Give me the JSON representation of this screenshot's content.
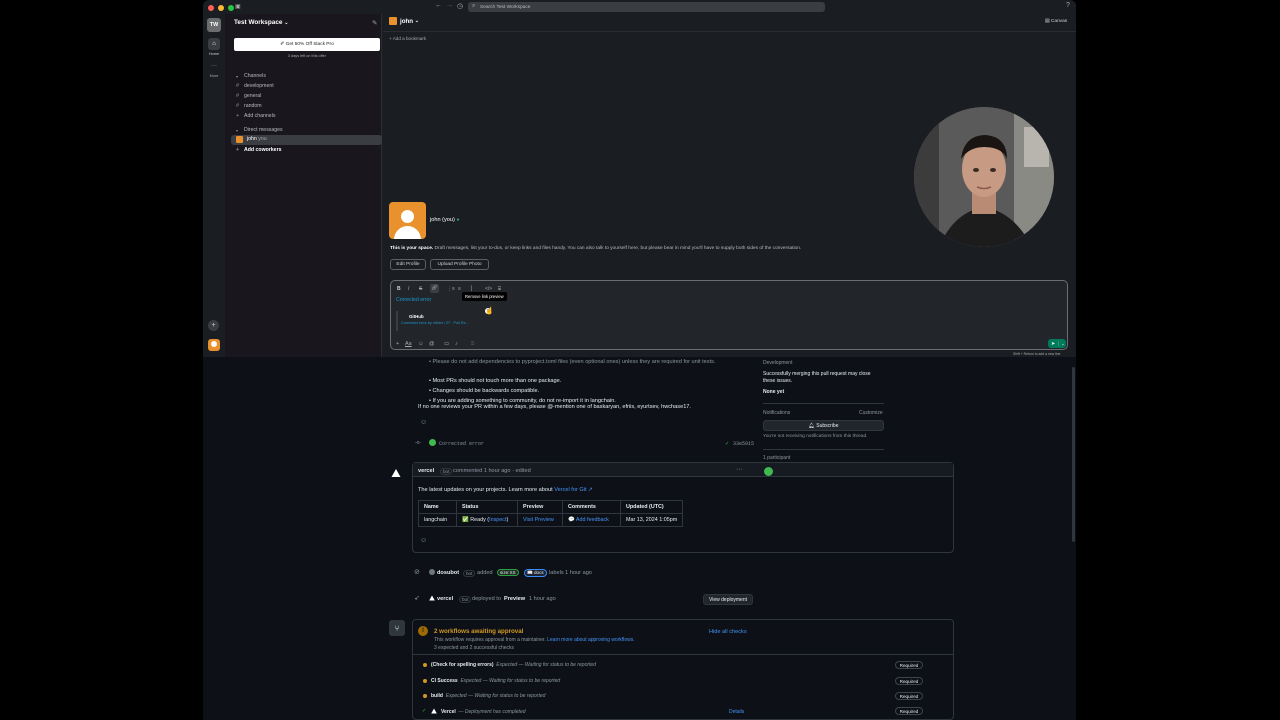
{
  "slack": {
    "search_placeholder": "Search Test Workspace",
    "rail": {
      "workspace_initials": "TW",
      "home_label": "Home",
      "more_label": "More"
    },
    "workspace_name": "Test Workspace",
    "promo": {
      "button_label": "Get 50% Off Slack Pro",
      "subtext": "3 days left on this offer"
    },
    "channels": {
      "header": "Channels",
      "items": [
        "development",
        "general",
        "random"
      ],
      "add_label": "Add channels"
    },
    "dms": {
      "header": "Direct messages",
      "self_name": "john",
      "self_suffix": "you",
      "add_label": "Add coworkers"
    },
    "header": {
      "dm_name": "john",
      "canvas_label": "Canvas",
      "bookmark_label": "Add a bookmark"
    },
    "profile": {
      "name": "john (you)",
      "intro_bold": "This is your space.",
      "intro_rest": " Draft messages, list your to-dos, or keep links and files handy. You can also talk to yourself here, but please bear in mind you'll have to supply both sides of the conversation.",
      "edit_button": "Edit Profile",
      "upload_button": "Upload Profile Photo"
    },
    "composer": {
      "link_text": "Corrected error",
      "tooltip": "Remove link preview",
      "preview_title": "GitHub",
      "preview_subtitle": "Corrected error by nilhim / 27 · Pull Re...",
      "hint": "Shift + Return to add a new line"
    }
  },
  "github": {
    "bullets": [
      "Please do not add dependencies to pyproject.toml files (even optional ones) unless they are required for unit tests.",
      "Most PRs should not touch more than one package.",
      "Changes should be backwards compatible.",
      "If you are adding something to community, do not re-import it in langchain."
    ],
    "mention_text": "If no one reviews your PR within a few days, please @-mention one of baskaryan, efriis, eyurtsev, hwchase17.",
    "commit": {
      "message": "Corrected error",
      "sha": "33e5915"
    },
    "vercel_comment": {
      "author": "vercel",
      "bot_tag": "bot",
      "meta": "commented 1 hour ago · edited",
      "intro": "The latest updates on your projects. Learn more about ",
      "intro_link": "Vercel for Git ↗",
      "table_headers": [
        "Name",
        "Status",
        "Preview",
        "Comments",
        "Updated (UTC)"
      ],
      "row": {
        "name": "langchain",
        "status_prefix": "✅ Ready (",
        "status_link": "Inspect",
        "status_suffix": ")",
        "preview": "Visit Preview",
        "comments": "💬 Add feedback",
        "updated": "Mar 13, 2024 1:05pm"
      }
    },
    "labels_event": {
      "author": "dosubot",
      "bot_tag": "bot",
      "action": "added",
      "label1": "size:XS",
      "label2": "📖 docs",
      "suffix": "labels 1 hour ago"
    },
    "deploy_event": {
      "author": "vercel",
      "bot_tag": "bot",
      "action": "deployed to",
      "env": "Preview",
      "time": "1 hour ago",
      "button": "View deployment"
    },
    "checks": {
      "title": "2 workflows awaiting approval",
      "hide_link": "Hide all checks",
      "desc": "This workflow requires approval from a maintainer. ",
      "desc_link": "Learn more about approving workflows.",
      "summary": "3 expected and 2 successful checks",
      "items": [
        {
          "name": "(Check for spelling errors)",
          "status": "Expected — Waiting for status to be reported",
          "badge": "Required"
        },
        {
          "name": "CI Success",
          "status": "Expected — Waiting for status to be reported",
          "badge": "Required"
        },
        {
          "name": "build",
          "status": "Expected — Waiting for status to be reported",
          "badge": "Required"
        },
        {
          "name": "Vercel",
          "status": "— Deployment has completed",
          "badge": "Required",
          "details": "Details"
        }
      ]
    },
    "sidebar": {
      "dev_label": "Development",
      "dev_text_1": "Successfully merging this pull request may close",
      "dev_text_2": "these issues.",
      "dev_none": "None yet",
      "notif_label": "Notifications",
      "customize": "Customize",
      "subscribe": "Subscribe",
      "notif_text": "You're not receiving notifications from this thread.",
      "participants": "1 participant"
    }
  },
  "colors": {
    "slack_bg": "#1a1d21",
    "github_bg": "#0d1117",
    "accent_green": "#007a5a",
    "link_blue": "#4493f8",
    "warning": "#d29922"
  }
}
